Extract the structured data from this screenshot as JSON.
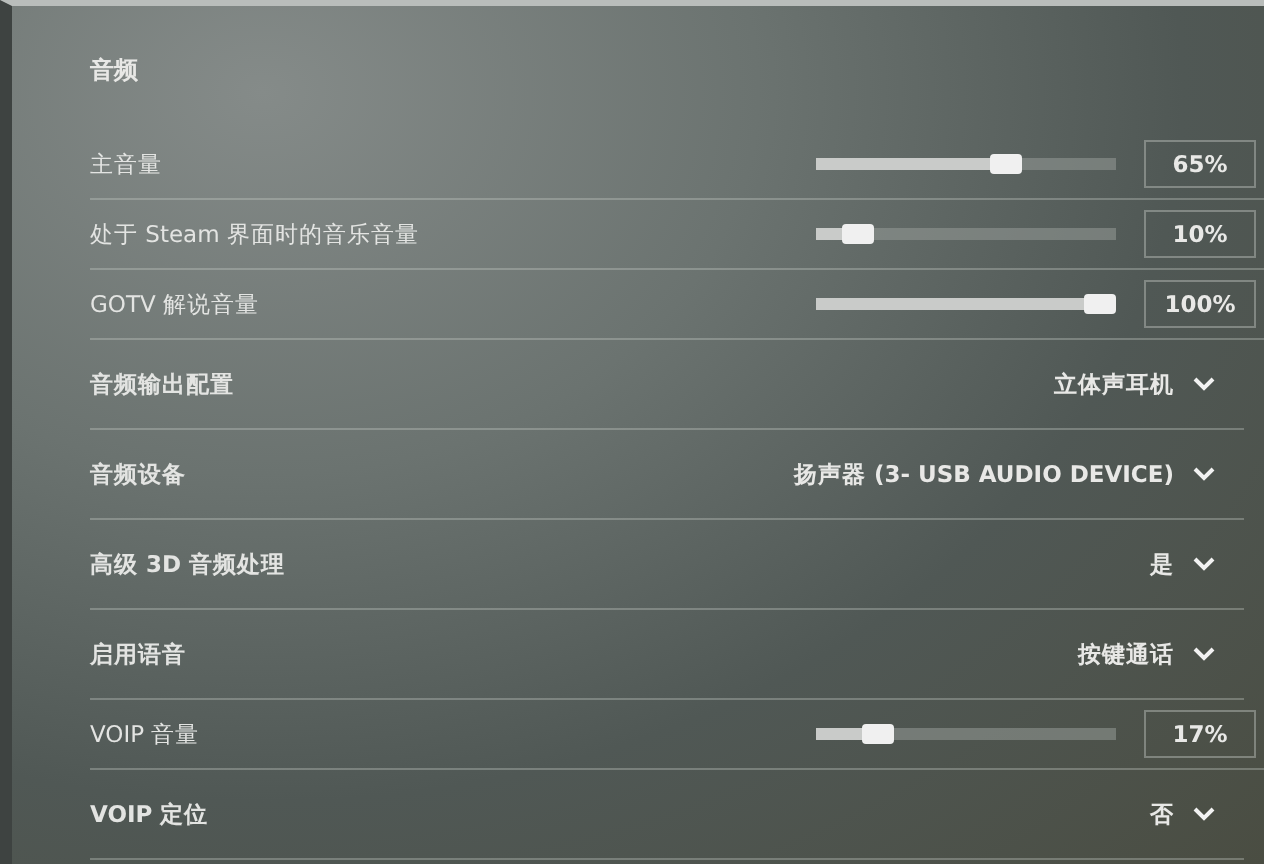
{
  "section": {
    "title": "音频"
  },
  "settings": [
    {
      "kind": "slider",
      "label": "主音量",
      "level": 0.65,
      "reading": "65%"
    },
    {
      "kind": "slider",
      "label": "处于 Steam 界面时的音乐音量",
      "level": 0.1,
      "reading": "10%"
    },
    {
      "kind": "slider",
      "label": "GOTV 解说音量",
      "level": 1,
      "reading": "100%"
    },
    {
      "kind": "dropdown",
      "label": "音频输出配置",
      "value": "立体声耳机"
    },
    {
      "kind": "dropdown",
      "label": "音频设备",
      "value": "扬声器 (3- USB AUDIO DEVICE)"
    },
    {
      "kind": "dropdown",
      "label": "高级 3D 音频处理",
      "value": "是"
    },
    {
      "kind": "dropdown",
      "label": "启用语音",
      "value": "按键通话"
    },
    {
      "kind": "slider",
      "label": "VOIP 音量",
      "level": 0.17,
      "reading": "17%"
    },
    {
      "kind": "dropdown",
      "label": "VOIP 定位",
      "value": "否"
    }
  ]
}
